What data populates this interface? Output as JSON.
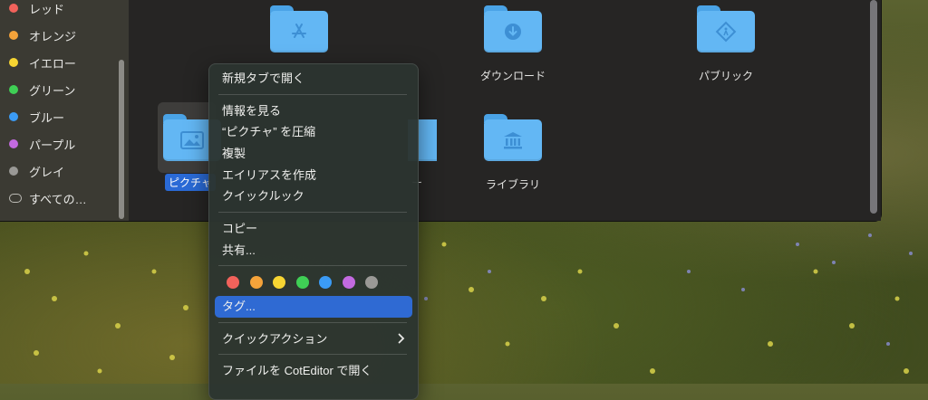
{
  "sidebar": {
    "tags": [
      {
        "label": "レッド",
        "color": "#f2625b"
      },
      {
        "label": "オレンジ",
        "color": "#f5a33a"
      },
      {
        "label": "イエロー",
        "color": "#f7d532"
      },
      {
        "label": "グリーン",
        "color": "#3fcf55"
      },
      {
        "label": "ブルー",
        "color": "#3b9bf5"
      },
      {
        "label": "パープル",
        "color": "#c36ae0"
      },
      {
        "label": "グレイ",
        "color": "#9a9996"
      }
    ],
    "all_tags_label": "すべての…"
  },
  "folders": {
    "applications": {
      "label": "",
      "icon": "applications-icon"
    },
    "downloads": {
      "label": "ダウンロード",
      "icon": "download-icon"
    },
    "public": {
      "label": "パブリック",
      "icon": "public-icon"
    },
    "pictures": {
      "label": "ピクチャ",
      "icon": "photo-icon"
    },
    "hidden": {
      "label": "ー",
      "icon": "folder-icon"
    },
    "library": {
      "label": "ライブラリ",
      "icon": "library-icon"
    }
  },
  "context_menu": {
    "open_new_tab": "新規タブで開く",
    "get_info": "情報を見る",
    "compress": "“ピクチャ” を圧縮",
    "duplicate": "複製",
    "make_alias": "エイリアスを作成",
    "quick_look": "クイックルック",
    "copy": "コピー",
    "share": "共有...",
    "tag_colors": [
      "#f2625b",
      "#f5a33a",
      "#f7d532",
      "#3fcf55",
      "#3b9bf5",
      "#c36ae0",
      "#9a9996"
    ],
    "tags": "タグ...",
    "quick_actions": "クイックアクション",
    "open_with": "ファイルを CotEditor で開く"
  }
}
